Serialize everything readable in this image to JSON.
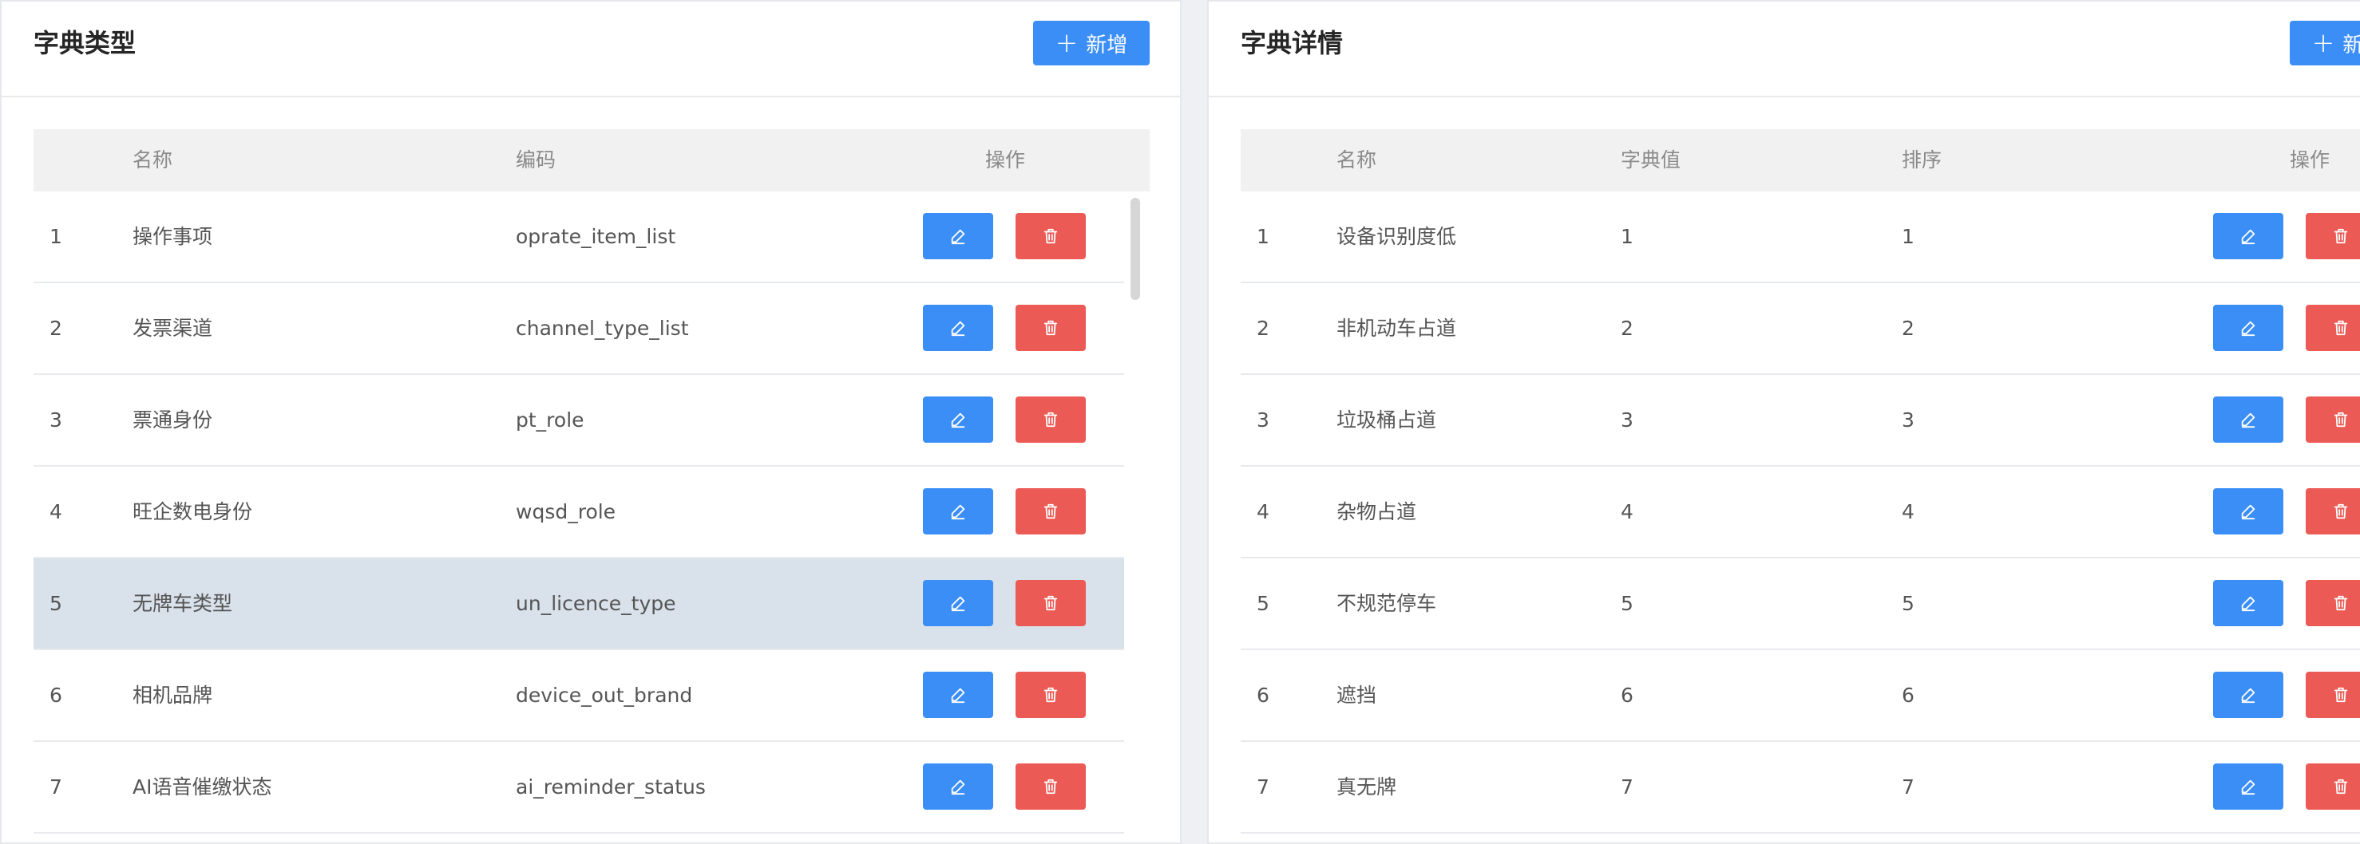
{
  "left_panel": {
    "title": "字典类型",
    "add_button": {
      "plus": "+",
      "label": "新增"
    },
    "columns": {
      "name": "名称",
      "code": "编码",
      "actions": "操作"
    },
    "rows": [
      {
        "index": "1",
        "name": "操作事项",
        "code": "oprate_item_list"
      },
      {
        "index": "2",
        "name": "发票渠道",
        "code": "channel_type_list"
      },
      {
        "index": "3",
        "name": "票通身份",
        "code": "pt_role"
      },
      {
        "index": "4",
        "name": "旺企数电身份",
        "code": "wqsd_role"
      },
      {
        "index": "5",
        "name": "无牌车类型",
        "code": "un_licence_type"
      },
      {
        "index": "6",
        "name": "相机品牌",
        "code": "device_out_brand"
      },
      {
        "index": "7",
        "name": "AI语音催缴状态",
        "code": "ai_reminder_status"
      }
    ],
    "selected_row": "5"
  },
  "right_panel": {
    "title": "字典详情",
    "add_button": {
      "plus": "+",
      "label": "新增"
    },
    "columns": {
      "name": "名称",
      "value": "字典值",
      "sort": "排序",
      "actions": "操作"
    },
    "rows": [
      {
        "index": "1",
        "name": "设备识别度低",
        "value": "1",
        "sort": "1"
      },
      {
        "index": "2",
        "name": "非机动车占道",
        "value": "2",
        "sort": "2"
      },
      {
        "index": "3",
        "name": "垃圾桶占道",
        "value": "3",
        "sort": "3"
      },
      {
        "index": "4",
        "name": "杂物占道",
        "value": "4",
        "sort": "4"
      },
      {
        "index": "5",
        "name": "不规范停车",
        "value": "5",
        "sort": "5"
      },
      {
        "index": "6",
        "name": "遮挡",
        "value": "6",
        "sort": "6"
      },
      {
        "index": "7",
        "name": "真无牌",
        "value": "7",
        "sort": "7"
      }
    ]
  },
  "colors": {
    "primary": "#3b8ef6",
    "danger": "#ec5a55",
    "header_bg": "#f1f1f1",
    "selected_row": "#d9e1ea"
  },
  "icons": {
    "edit": "pencil-icon",
    "delete": "trash-icon",
    "add": "plus-icon"
  }
}
